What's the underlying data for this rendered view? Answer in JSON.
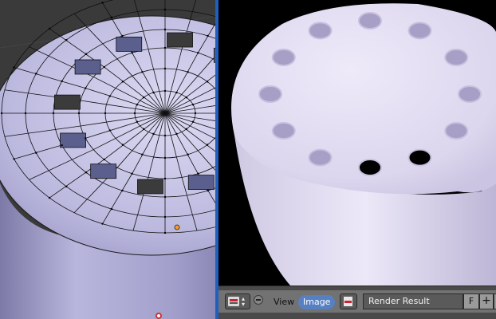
{
  "image_editor": {
    "header": {
      "editor_type_icon": "image-editor-icon",
      "collapse_icon": "minus-icon",
      "menu_view": "View",
      "menu_image": "Image",
      "browse_icon": "render-image-icon",
      "image_name": "Render Result",
      "fake_user_label": "F",
      "new_image_icon": "plus-icon"
    }
  },
  "viewport3d": {
    "cursor_icon": "3d-cursor-icon"
  },
  "colors": {
    "header_bg": "#4a4a4a",
    "active_menu": "#5680c2",
    "selected_border": "#1f5fbf",
    "mesh_face": "#9a97c4",
    "render_surface": "#d6cfea"
  }
}
